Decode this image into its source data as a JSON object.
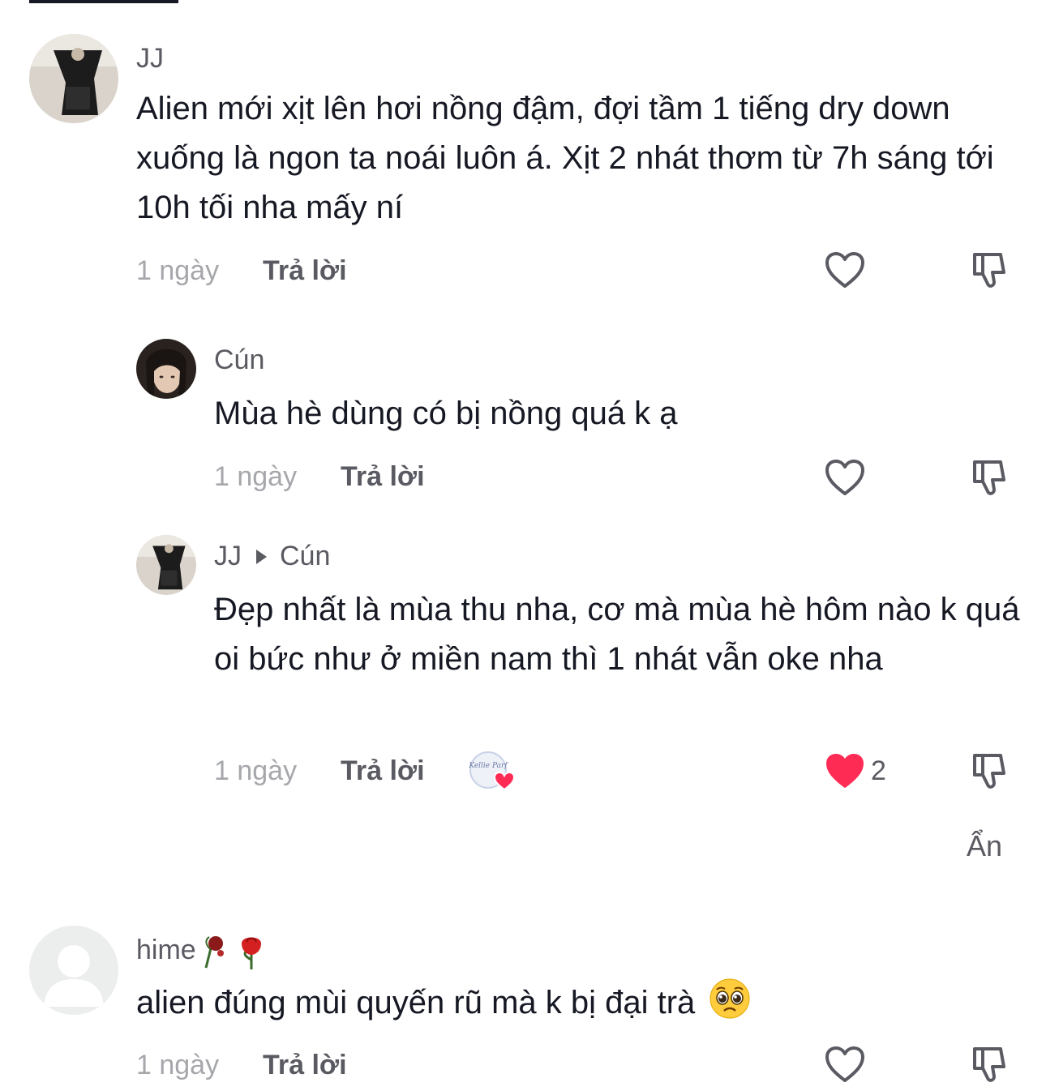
{
  "comments": [
    {
      "username": "JJ",
      "text": "Alien mới xịt lên hơi nồng đậm, đợi tầm 1 tiếng dry down xuống là ngon ta noái luôn á. Xịt 2 nhát thơm từ 7h sáng tới 10h tối nha mấy ní",
      "time": "1 ngày",
      "reply_label": "Trả lời",
      "replies": [
        {
          "username": "Cún",
          "text": "Mùa hè dùng có bị nồng quá k ạ",
          "time": "1 ngày",
          "reply_label": "Trả lời"
        },
        {
          "username": "JJ",
          "reply_to": "Cún",
          "text": "Đẹp nhất là mùa thu nha, cơ mà mùa hè hôm nào k quá oi bức như ở miền nam thì 1 nhát vẫn oke nha",
          "time": "1 ngày",
          "reply_label": "Trả lời",
          "like_count": "2",
          "liked": true,
          "badge_text": "Kellie Parf"
        }
      ],
      "hide_label": "Ẩn"
    },
    {
      "username": "hime",
      "text": "alien đúng mùi quyến rũ mà k bị đại trà",
      "text_emoji": "🥺",
      "time": "1 ngày",
      "reply_label": "Trả lời"
    }
  ],
  "colors": {
    "liked_heart": "#fe2c55",
    "text": "#161823",
    "muted": "#a6a7ab",
    "secondary": "#5a5b62"
  }
}
